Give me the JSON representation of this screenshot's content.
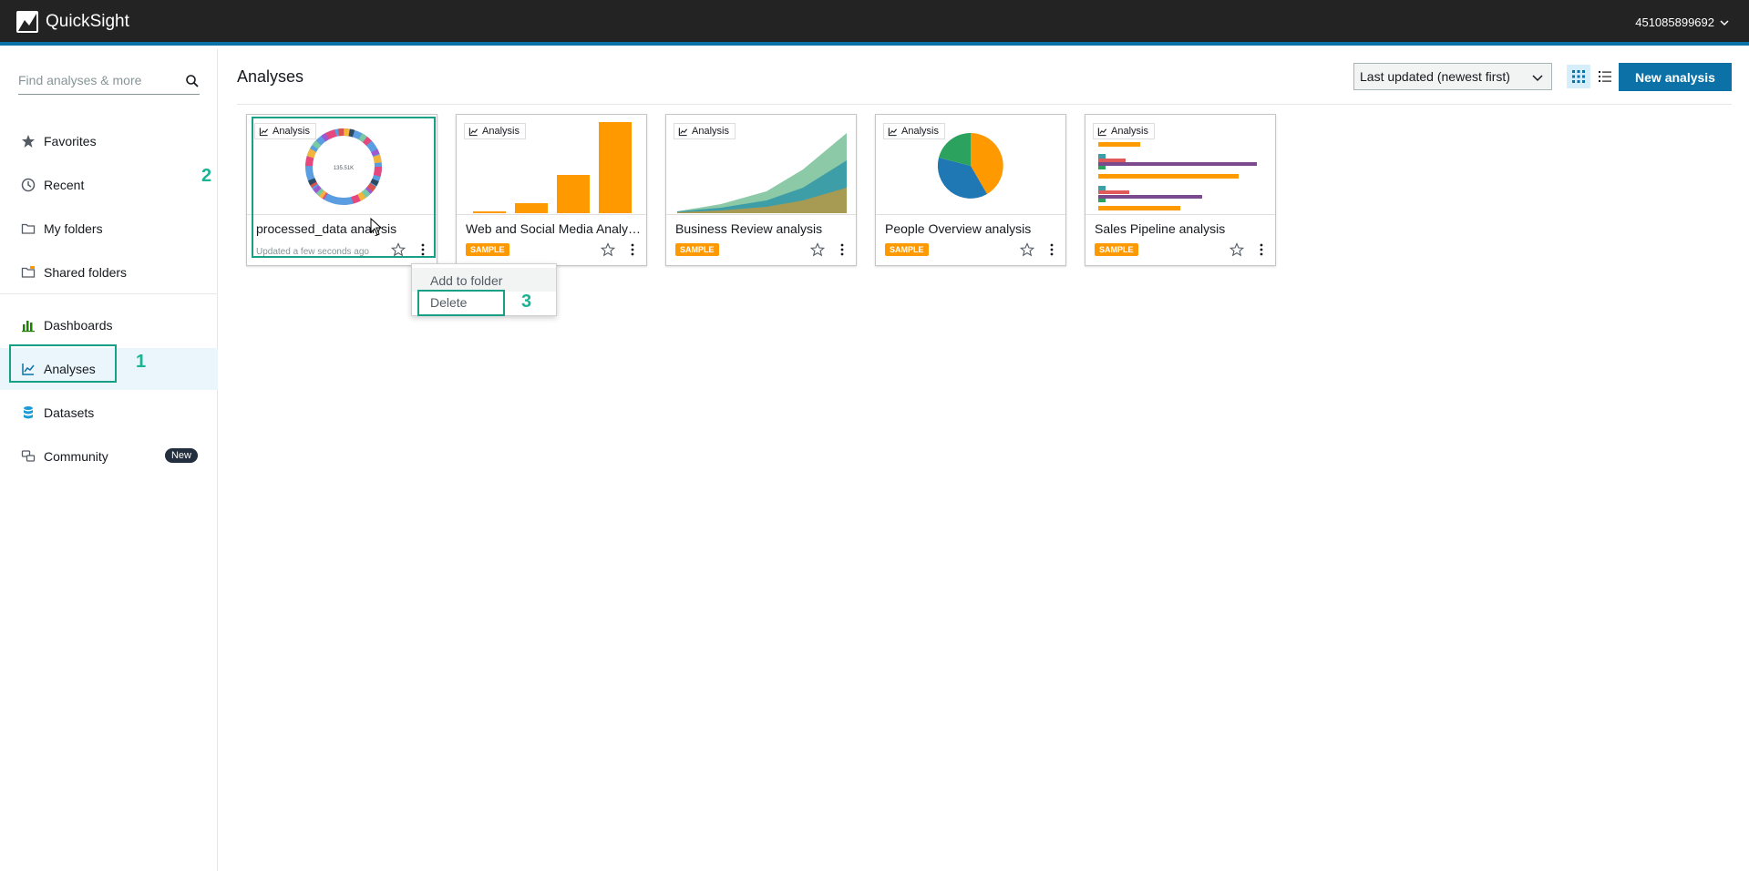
{
  "app": {
    "name": "QuickSight",
    "account": "451085899692"
  },
  "sidebar": {
    "search_placeholder": "Find analyses & more",
    "items": [
      {
        "label": "Favorites",
        "icon": "star-icon"
      },
      {
        "label": "Recent",
        "icon": "clock-icon"
      },
      {
        "label": "My folders",
        "icon": "folder-icon"
      },
      {
        "label": "Shared folders",
        "icon": "shared-folder-icon"
      },
      {
        "label": "Dashboards",
        "icon": "dashboard-icon"
      },
      {
        "label": "Analyses",
        "icon": "analysis-icon",
        "active": true
      },
      {
        "label": "Datasets",
        "icon": "dataset-icon"
      },
      {
        "label": "Community",
        "icon": "community-icon",
        "badge": "New"
      }
    ]
  },
  "main": {
    "title": "Analyses",
    "sort_value": "Last updated (newest first)",
    "new_button": "New analysis",
    "cards": [
      {
        "tag": "Analysis",
        "name": "processed_data analysis",
        "sub": "Updated a few seconds ago",
        "center_label": "135.51K"
      },
      {
        "tag": "Analysis",
        "name": "Web and Social Media Analytics analysis",
        "badge": "SAMPLE"
      },
      {
        "tag": "Analysis",
        "name": "Business Review analysis",
        "badge": "SAMPLE"
      },
      {
        "tag": "Analysis",
        "name": "People Overview analysis",
        "badge": "SAMPLE"
      },
      {
        "tag": "Analysis",
        "name": "Sales Pipeline analysis",
        "badge": "SAMPLE"
      }
    ]
  },
  "context_menu": {
    "items": [
      "Add to folder",
      "Delete"
    ]
  },
  "annotations": [
    "1",
    "2",
    "3"
  ],
  "colors": {
    "accent": "#0b71a6",
    "annotation": "#16a085",
    "sample": "#ff9900"
  }
}
